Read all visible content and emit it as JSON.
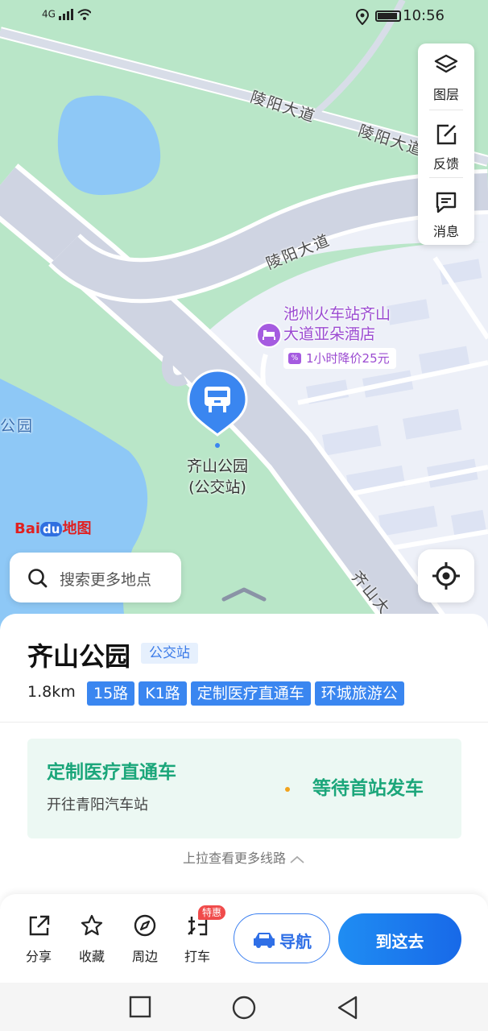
{
  "status_bar": {
    "signal": "4G",
    "time": "10:56"
  },
  "map": {
    "road_labels": [
      "陵阳大道",
      "陵阳大道",
      "陵阳大道",
      "齐山大"
    ],
    "park_label": "公园",
    "hotel": {
      "name_line1": "池州火车站齐山",
      "name_line2": "大道亚朵酒店",
      "promo": "1小时降价25元",
      "promo_tag": "%"
    },
    "bus_stop": {
      "line1": "齐山公园",
      "line2": "(公交站)"
    },
    "logo": {
      "left": "Bai",
      "middle": "du",
      "right": "地图"
    }
  },
  "tools": [
    {
      "label": "图层",
      "icon": "layers-icon"
    },
    {
      "label": "反馈",
      "icon": "feedback-edit-icon"
    },
    {
      "label": "消息",
      "icon": "message-icon"
    }
  ],
  "search": {
    "placeholder": "搜索更多地点"
  },
  "place": {
    "title": "齐山公园",
    "type": "公交站",
    "distance": "1.8km",
    "routes": [
      "15路",
      "K1路",
      "定制医疗直通车",
      "环城旅游公"
    ]
  },
  "line_card": {
    "name": "定制医疗直通车",
    "direction": "开往青阳汽车站",
    "status": "等待首站发车"
  },
  "more_lines": "上拉查看更多线路",
  "actions": [
    {
      "label": "分享",
      "icon": "share-icon"
    },
    {
      "label": "收藏",
      "icon": "star-icon"
    },
    {
      "label": "周边",
      "icon": "compass-icon"
    },
    {
      "label": "打车",
      "icon": "taxi-icon"
    }
  ],
  "badge": "特惠",
  "nav_button": "导航",
  "go_button": "到这去",
  "colors": {
    "accent": "#3a86f0",
    "green": "#1ba67a",
    "hotel": "#9b4bd1",
    "map_green": "#b9e6c8",
    "water": "#8ec8f6"
  }
}
